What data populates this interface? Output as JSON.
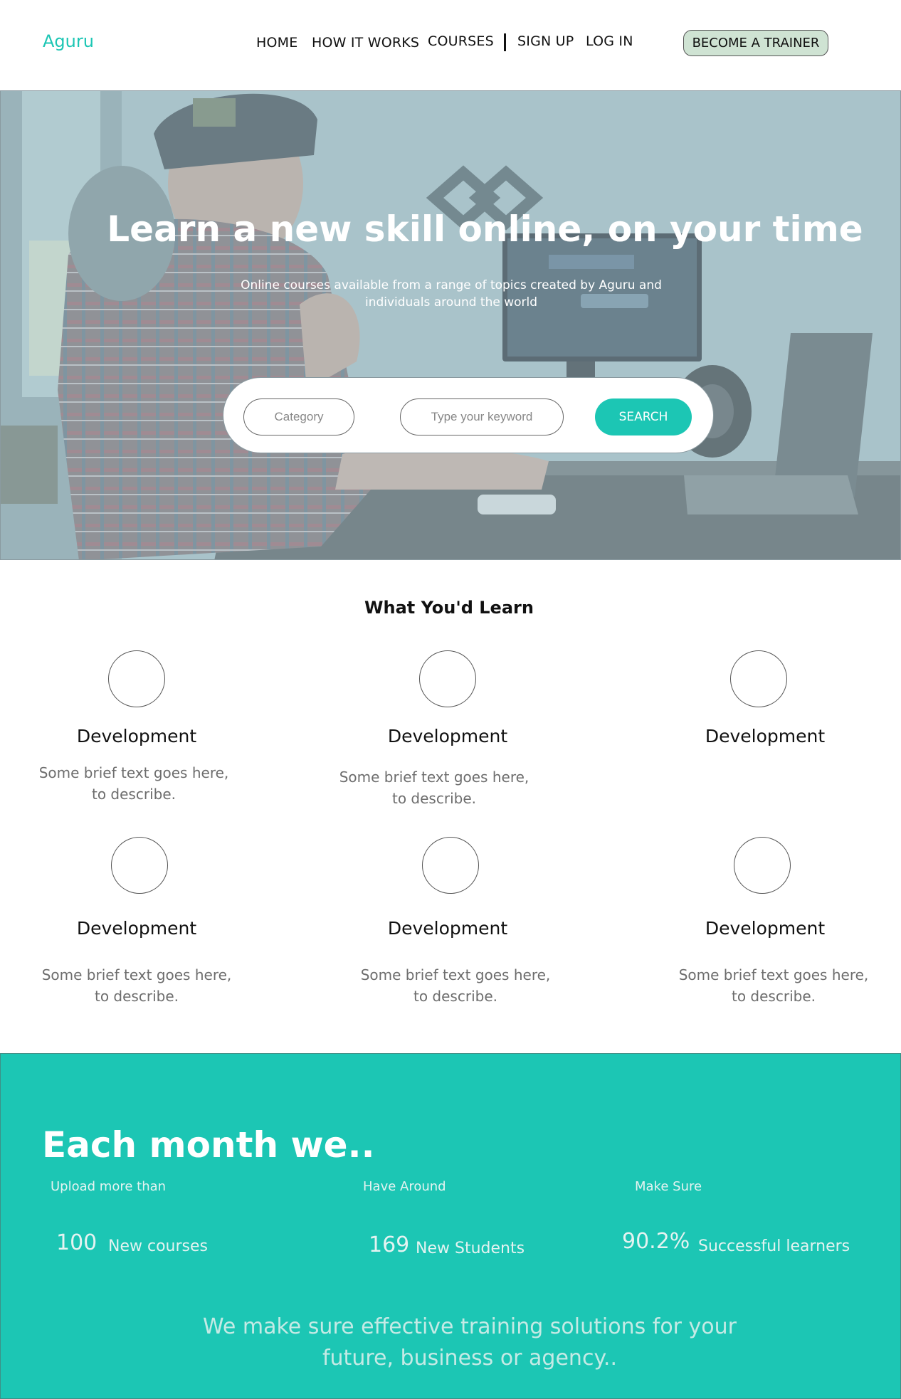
{
  "brand": {
    "logo": "Aguru",
    "accent": "#1cc6b4"
  },
  "nav": {
    "home": "HOME",
    "how_it_works": "HOW IT WORKS",
    "courses": "COURSES",
    "sign_up": "SIGN UP",
    "log_in": "LOG IN",
    "cta": "BECOME A TRAINER"
  },
  "hero": {
    "title": "Learn a new skill online, on your time",
    "subtitle": "Online courses available from a range of topics created by Aguru and individuals around the world",
    "search": {
      "category_placeholder": "Category",
      "keyword_placeholder": "Type your keyword",
      "button": "SEARCH"
    }
  },
  "learn": {
    "title": "What You'd Learn",
    "items": [
      {
        "title": "Development",
        "desc_line1": "Some brief text goes here,",
        "desc_line2": "to describe."
      },
      {
        "title": "Development",
        "desc_line1": "Some brief text goes here,",
        "desc_line2": "to describe."
      },
      {
        "title": "Development",
        "desc_line1": "",
        "desc_line2": ""
      },
      {
        "title": "Development",
        "desc_line1": "Some brief text goes here,",
        "desc_line2": "to describe."
      },
      {
        "title": "Development",
        "desc_line1": "Some brief text goes here,",
        "desc_line2": "to describe."
      },
      {
        "title": "Development",
        "desc_line1": "Some brief text goes here,",
        "desc_line2": "to describe."
      }
    ]
  },
  "stats": {
    "title": "Each month we..",
    "items": [
      {
        "label": "Upload more than",
        "value": "100",
        "unit": "New courses"
      },
      {
        "label": "Have Around",
        "value": "169",
        "unit": "New Students"
      },
      {
        "label": "Make Sure",
        "value": "90.2%",
        "unit": "Successful learners"
      }
    ],
    "tagline_line1": "We make sure effective training solutions for your",
    "tagline_line2": "future, business or agency.."
  }
}
